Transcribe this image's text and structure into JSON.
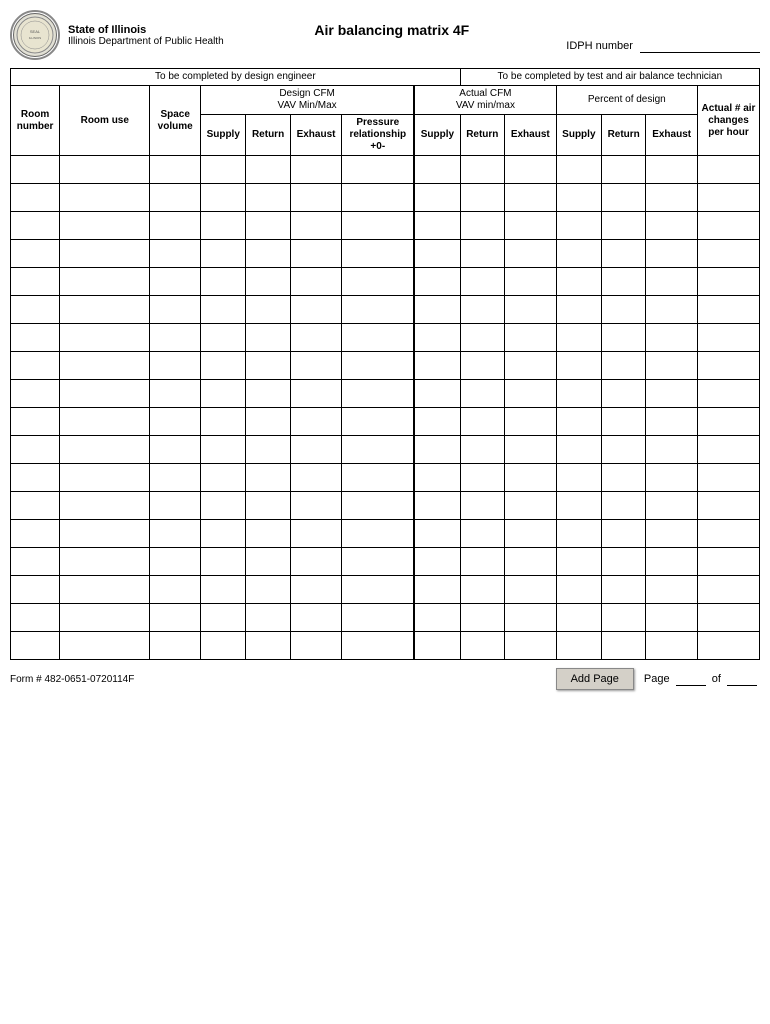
{
  "header": {
    "state": "State of Illinois",
    "department": "Illinois Department of Public Health",
    "title": "Air balancing matrix  4F",
    "idph_label": "IDPH number"
  },
  "sections": {
    "design_engineer": "To be completed by  design engineer",
    "technician": "To be completed by test and air balance technician"
  },
  "subsections": {
    "design_cfm": "Design CFM",
    "vav_minmax": "VAV Min/Max",
    "actual_cfm": "Actual CFM",
    "vav_minmax2": "VAV min/max",
    "percent_design": "Percent of design"
  },
  "columns": {
    "room_number": "Room number",
    "room_use": "Room use",
    "space_volume": "Space volume",
    "supply": "Supply",
    "return": "Return",
    "exhaust": "Exhaust",
    "pressure_relationship": "Pressure relationship +0-",
    "supply2": "Supply",
    "return2": "Return",
    "exhaust2": "Exhaust",
    "supply3": "Supply",
    "return3": "Return",
    "exhaust3": "Exhaust",
    "actual_air_changes": "Actual # air changes per hour"
  },
  "footer": {
    "form_number": "Form # 482-0651-0720114F",
    "add_page": "Add Page",
    "page_label": "Page",
    "of_label": "of"
  },
  "data_rows": 18
}
